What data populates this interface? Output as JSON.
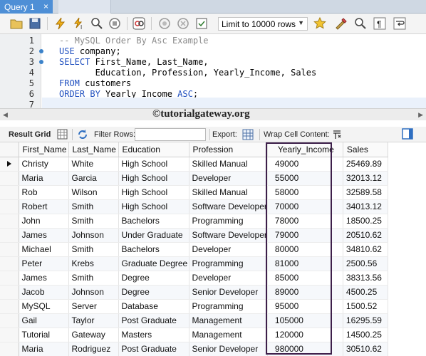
{
  "tabs": [
    {
      "label": "Query 1",
      "close": "×"
    },
    {
      "label": ""
    }
  ],
  "toolbar": {
    "limit_label": "Limit to 10000 rows",
    "icons": [
      "folder-icon",
      "save-icon",
      "lightning-icon",
      "lightning-cursor-icon",
      "magnifier-icon",
      "stop-icon",
      "toggle-icon",
      "commit-icon",
      "rollback-icon",
      "autocommit-icon",
      "limit-dropdown",
      "bookmark-icon",
      "beautify-icon",
      "find-icon",
      "invisible-chars-icon",
      "wrap-icon"
    ]
  },
  "editor": {
    "lines": [
      {
        "n": "1",
        "text": "-- MySQL Order By Asc Example"
      },
      {
        "n": "2",
        "text": "USE company;"
      },
      {
        "n": "3",
        "text": "SELECT First_Name, Last_Name,"
      },
      {
        "n": "4",
        "text": "       Education, Profession, Yearly_Income, Sales"
      },
      {
        "n": "5",
        "text": "FROM customers"
      },
      {
        "n": "6",
        "text": "ORDER BY Yearly_Income ASC;"
      },
      {
        "n": "7",
        "text": ""
      }
    ]
  },
  "watermark": "©tutorialgateway.org",
  "result_toolbar": {
    "result_grid": "Result Grid",
    "filter_rows": "Filter Rows:",
    "filter_value": "",
    "export": "Export:",
    "wrap_cell": "Wrap Cell Content:"
  },
  "grid": {
    "columns": [
      "First_Name",
      "Last_Name",
      "Education",
      "Profession",
      "Yearly_Income",
      "Sales"
    ],
    "rows": [
      [
        "Christy",
        "White",
        "High School",
        "Skilled Manual",
        "49000",
        "25469.89"
      ],
      [
        "Maria",
        "Garcia",
        "High School",
        "Developer",
        "55000",
        "32013.12"
      ],
      [
        "Rob",
        "Wilson",
        "High School",
        "Skilled Manual",
        "58000",
        "32589.58"
      ],
      [
        "Robert",
        "Smith",
        "High School",
        "Software Developer",
        "70000",
        "34013.12"
      ],
      [
        "John",
        "Smith",
        "Bachelors",
        "Programming",
        "78000",
        "18500.25"
      ],
      [
        "James",
        "Johnson",
        "Under Graduate",
        "Software Developer",
        "79000",
        "20510.62"
      ],
      [
        "Michael",
        "Smith",
        "Bachelors",
        "Developer",
        "80000",
        "34810.62"
      ],
      [
        "Peter",
        "Krebs",
        "Graduate Degree",
        "Programming",
        "81000",
        "2500.56"
      ],
      [
        "James",
        "Smith",
        "Degree",
        "Developer",
        "85000",
        "38313.56"
      ],
      [
        "Jacob",
        "Johnson",
        "Degree",
        "Senior Developer",
        "89000",
        "4500.25"
      ],
      [
        "MySQL",
        "Server",
        "Database",
        "Programming",
        "95000",
        "1500.52"
      ],
      [
        "Gail",
        "Taylor",
        "Post Graduate",
        "Management",
        "105000",
        "16295.59"
      ],
      [
        "Tutorial",
        "Gateway",
        "Masters",
        "Management",
        "120000",
        "14500.25"
      ],
      [
        "Maria",
        "Rodriguez",
        "Post Graduate",
        "Senior Developer",
        "980000",
        "30510.62"
      ]
    ]
  },
  "colors": {
    "tab_active": "#4e8fd6",
    "keyword": "#1f4fbf",
    "comment": "#8a8a8a",
    "highlight_frame": "#3d1f4a"
  }
}
